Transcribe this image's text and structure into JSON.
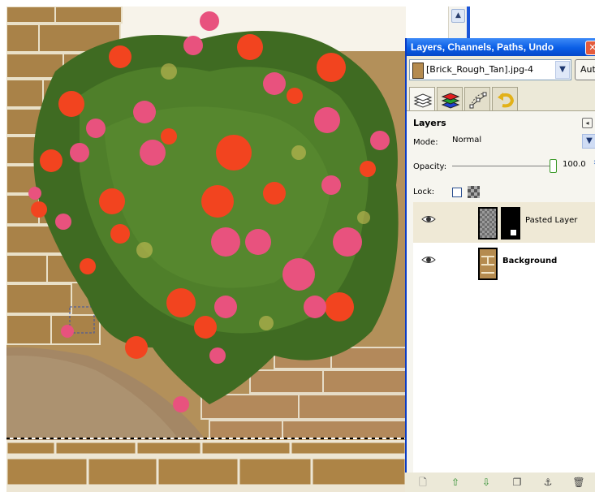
{
  "dock": {
    "title": "Layers, Channels, Paths, Undo",
    "close_glyph": "✕",
    "image_name": "[Brick_Rough_Tan].jpg-4",
    "auto_label": "Auto",
    "tabs": [
      {
        "icon": "layers-tab-icon",
        "active": true
      },
      {
        "icon": "channels-tab-icon",
        "active": false
      },
      {
        "icon": "paths-tab-icon",
        "active": false
      },
      {
        "icon": "undo-tab-icon",
        "active": false
      }
    ]
  },
  "layers_panel": {
    "heading": "Layers",
    "mode_label": "Mode:",
    "mode_value": "Normal",
    "opacity_label": "Opacity:",
    "opacity_value": "100.0",
    "opacity_fraction": 1.0,
    "lock_label": "Lock:",
    "layers": [
      {
        "name": "Pasted Layer",
        "visible": true,
        "selected": true,
        "has_mask": true
      },
      {
        "name": "Background",
        "visible": true,
        "selected": false,
        "has_mask": false
      }
    ]
  },
  "bottom_toolbar": [
    {
      "icon": "new-layer-icon",
      "glyph": "🗋"
    },
    {
      "icon": "raise-layer-icon",
      "glyph": "⇧"
    },
    {
      "icon": "lower-layer-icon",
      "glyph": "⇩"
    },
    {
      "icon": "duplicate-layer-icon",
      "glyph": "❐"
    },
    {
      "icon": "anchor-layer-icon",
      "glyph": "⚓"
    },
    {
      "icon": "delete-layer-icon",
      "glyph": "🗑"
    }
  ],
  "colors": {
    "title_bar": "#0a5ee6",
    "dock_bg": "#ece9d8",
    "panel_bg": "#f6f5ef",
    "selected_row": "#efe9d6",
    "flower_red": "#f2441f",
    "flower_pink": "#e8527e",
    "leaf_green": "#3f6b22",
    "brick": "#b08a55"
  }
}
